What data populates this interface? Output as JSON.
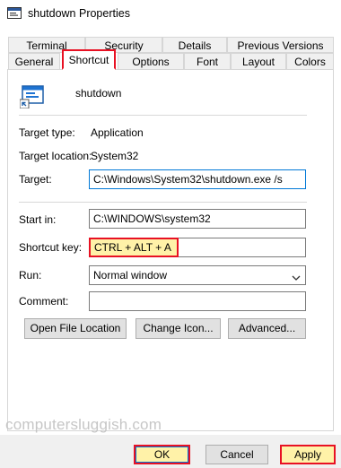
{
  "window": {
    "title": "shutdown Properties",
    "icon": "shortcut-app-icon"
  },
  "tabs_top": [
    {
      "label": "Terminal"
    },
    {
      "label": "Security"
    },
    {
      "label": "Details"
    },
    {
      "label": "Previous Versions"
    }
  ],
  "tabs_bottom": [
    {
      "label": "General"
    },
    {
      "label": "Shortcut"
    },
    {
      "label": "Options"
    },
    {
      "label": "Font"
    },
    {
      "label": "Layout"
    },
    {
      "label": "Colors"
    }
  ],
  "active_tab": "Shortcut",
  "shortcut": {
    "name": "shutdown",
    "icon": "application-icon",
    "target_type_label": "Target type:",
    "target_type_value": "Application",
    "target_location_label": "Target location:",
    "target_location_value": "System32",
    "target_label": "Target:",
    "target_value": "C:\\Windows\\System32\\shutdown.exe /s",
    "start_in_label": "Start in:",
    "start_in_value": "C:\\WINDOWS\\system32",
    "shortcut_key_label": "Shortcut key:",
    "shortcut_key_value": "CTRL + ALT + A",
    "run_label": "Run:",
    "run_value": "Normal window",
    "comment_label": "Comment:",
    "comment_value": "",
    "open_file_location_label": "Open File Location",
    "change_icon_label": "Change Icon...",
    "advanced_label": "Advanced..."
  },
  "watermark": "computersluggish.com",
  "footer": {
    "ok_label": "OK",
    "cancel_label": "Cancel",
    "apply_label": "Apply"
  },
  "colors": {
    "highlight_fill": "#fff2a8",
    "highlight_border": "#e81123",
    "focus_border": "#0078d7"
  }
}
